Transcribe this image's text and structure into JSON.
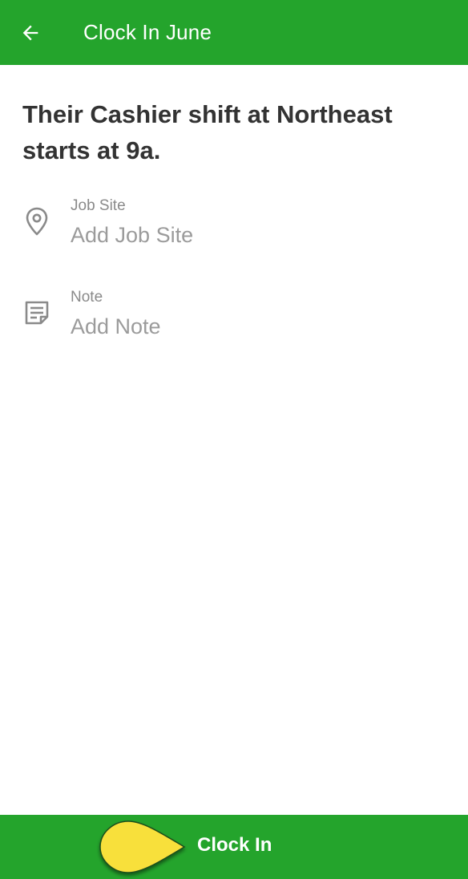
{
  "header": {
    "title": "Clock In June",
    "back_icon": "arrow-left-icon",
    "color": "#24a42c"
  },
  "main": {
    "headline": "Their Cashier shift at Northeast starts at 9a.",
    "fields": [
      {
        "icon": "location-pin-icon",
        "label": "Job Site",
        "placeholder": "Add Job Site"
      },
      {
        "icon": "note-icon",
        "label": "Note",
        "placeholder": "Add Note"
      }
    ]
  },
  "footer": {
    "button_label": "Clock In",
    "pointer_color": "#f8e03a"
  }
}
